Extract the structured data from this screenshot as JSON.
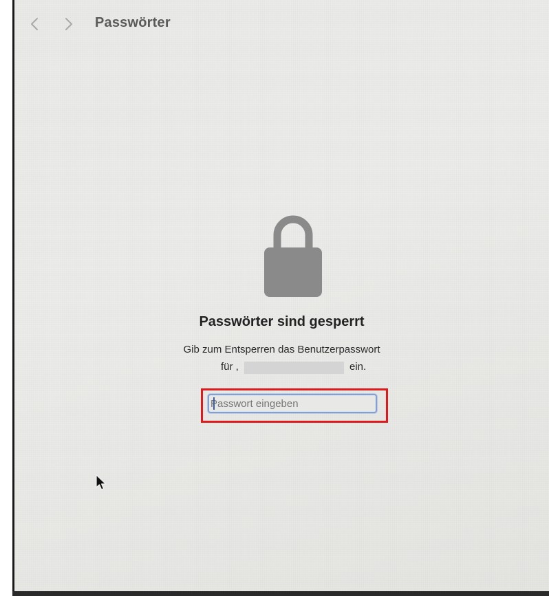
{
  "window": {
    "title": "Passwörter"
  },
  "toolbar": {
    "back_icon": "chevron-left-icon",
    "forward_icon": "chevron-right-icon"
  },
  "locked": {
    "icon": "lock-icon",
    "heading": "Passwörter sind gesperrt",
    "instruction_line1": "Gib zum Entsperren das Benutzerpasswort",
    "instruction_prefix": "für ,",
    "instruction_suffix": "ein."
  },
  "password_field": {
    "placeholder": "Passwort eingeben",
    "value": ""
  },
  "colors": {
    "highlight": "#e0191c",
    "field_focus": "#7f9fd6",
    "lock": "#8a8a8a"
  }
}
